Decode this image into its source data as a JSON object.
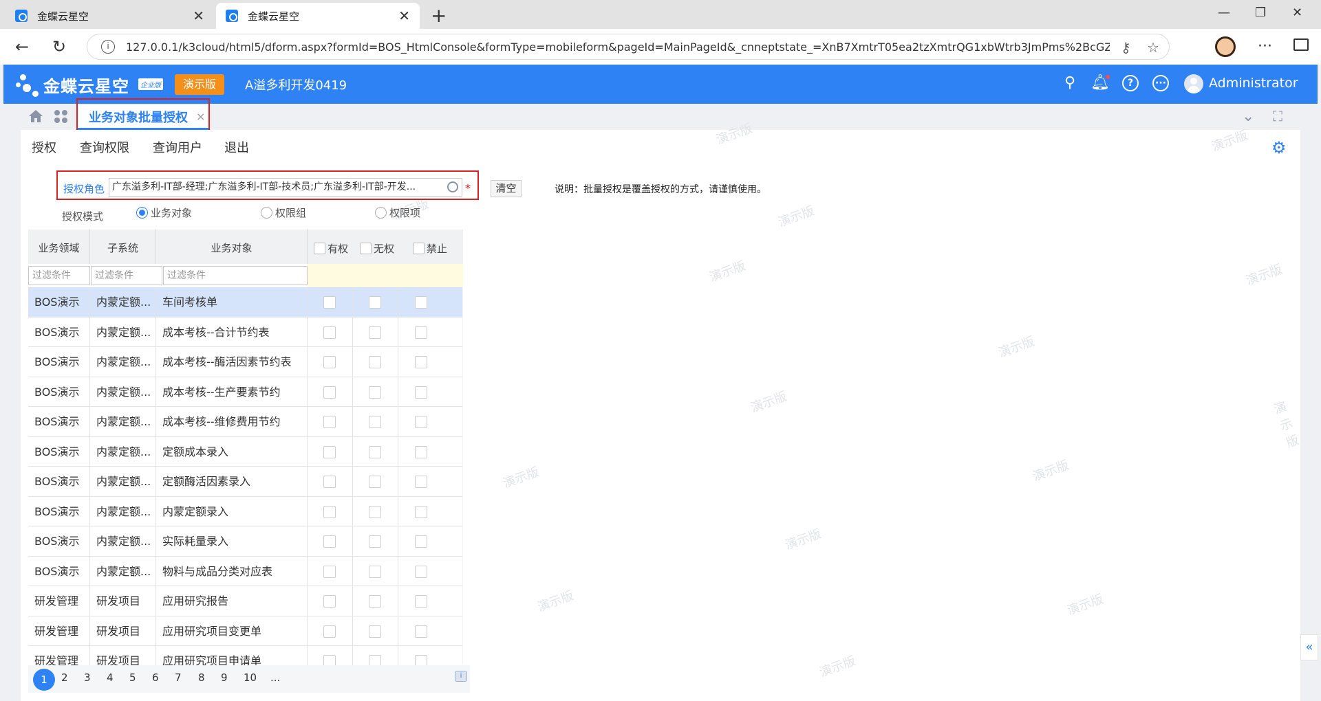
{
  "browser": {
    "tabs": [
      {
        "title": "金蝶云星空",
        "active": false
      },
      {
        "title": "金蝶云星空",
        "active": true
      }
    ],
    "url": "127.0.0.1/k3cloud/html5/dform.aspx?formId=BOS_HtmlConsole&formType=mobileform&pageId=MainPageId&_cnneptstate_=XnB7XmtrT05ea2tzXmtrQG1xbWtrb3JmPms%2BcGZtbzxs..."
  },
  "app": {
    "logo": "金蝶云星空",
    "logo_badge": "企业版",
    "demo_badge": "演示版",
    "company": "A溢多利开发0419",
    "user": "Administrator",
    "brand_color": "#2e82f4"
  },
  "page_tab": {
    "label": "业务对象批量授权",
    "close": "×"
  },
  "toolbar": {
    "items": [
      "授权",
      "查询权限",
      "查询用户",
      "退出"
    ]
  },
  "form": {
    "role_label": "授权角色",
    "role_value": "广东溢多利-IT部-经理;广东溢多利-IT部-技术员;广东溢多利-IT部-开发...",
    "required_mark": "*",
    "clear_label": "清空",
    "note": "说明：批量授权是覆盖授权的方式，请谨慎使用。",
    "mode_label": "授权模式",
    "modes": [
      {
        "label": "业务对象",
        "selected": true
      },
      {
        "label": "权限组",
        "selected": false
      },
      {
        "label": "权限项",
        "selected": false
      }
    ]
  },
  "grid": {
    "columns": {
      "domain": "业务领域",
      "subsystem": "子系统",
      "object": "业务对象",
      "has": "有权",
      "none": "无权",
      "forbid": "禁止"
    },
    "filter_placeholder": "过滤条件",
    "rows": [
      {
        "domain": "BOS演示",
        "subsystem": "内蒙定额...",
        "object": "车间考核单"
      },
      {
        "domain": "BOS演示",
        "subsystem": "内蒙定额...",
        "object": "成本考核--合计节约表"
      },
      {
        "domain": "BOS演示",
        "subsystem": "内蒙定额...",
        "object": "成本考核--酶活因素节约表"
      },
      {
        "domain": "BOS演示",
        "subsystem": "内蒙定额...",
        "object": "成本考核--生产要素节约"
      },
      {
        "domain": "BOS演示",
        "subsystem": "内蒙定额...",
        "object": "成本考核--维修费用节约"
      },
      {
        "domain": "BOS演示",
        "subsystem": "内蒙定额...",
        "object": "定额成本录入"
      },
      {
        "domain": "BOS演示",
        "subsystem": "内蒙定额...",
        "object": "定额酶活因素录入"
      },
      {
        "domain": "BOS演示",
        "subsystem": "内蒙定额...",
        "object": "内蒙定额录入"
      },
      {
        "domain": "BOS演示",
        "subsystem": "内蒙定额...",
        "object": "实际耗量录入"
      },
      {
        "domain": "BOS演示",
        "subsystem": "内蒙定额...",
        "object": "物料与成品分类对应表"
      },
      {
        "domain": "研发管理",
        "subsystem": "研发项目",
        "object": "应用研究报告"
      },
      {
        "domain": "研发管理",
        "subsystem": "研发项目",
        "object": "应用研究项目变更单"
      },
      {
        "domain": "研发管理",
        "subsystem": "研发项目",
        "object": "应用研究项目申请单"
      }
    ]
  },
  "pager": {
    "pages": [
      "1",
      "2",
      "3",
      "4",
      "5",
      "6",
      "7",
      "8",
      "9",
      "10",
      "..."
    ],
    "current": "1"
  },
  "watermark_text": "演示版"
}
